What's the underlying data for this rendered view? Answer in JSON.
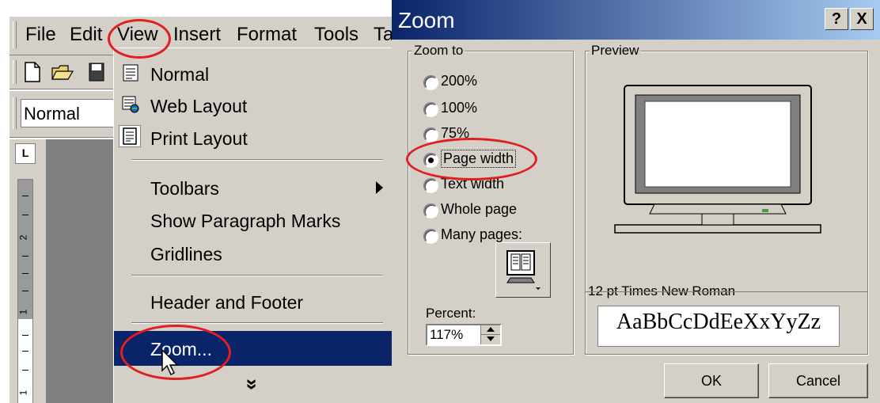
{
  "menubar": {
    "items": [
      {
        "label": "File",
        "mnemonic": "F"
      },
      {
        "label": "Edit",
        "mnemonic": "E"
      },
      {
        "label": "View",
        "mnemonic": "V"
      },
      {
        "label": "Insert",
        "mnemonic": "I"
      },
      {
        "label": "Format",
        "mnemonic": "o"
      },
      {
        "label": "Tools",
        "mnemonic": "T"
      },
      {
        "label": "Ta",
        "mnemonic": ""
      }
    ]
  },
  "toolbar": {
    "style_value": "Normal",
    "tab_selector": "L"
  },
  "ruler": {
    "numbers": [
      "2",
      "1",
      "1"
    ]
  },
  "view_menu": {
    "items": {
      "normal": "Normal",
      "web_layout": "Web Layout",
      "print_layout": "Print Layout",
      "toolbars": "Toolbars",
      "show_paragraph_marks": "Show Paragraph Marks",
      "gridlines": "Gridlines",
      "header_footer": "Header and Footer",
      "zoom": "Zoom...",
      "more": "»"
    }
  },
  "zoom_dialog": {
    "title": "Zoom",
    "help_button": "?",
    "close_button": "X",
    "zoom_to_label": "Zoom to",
    "options": [
      "200%",
      "100%",
      "75%",
      "Page width",
      "Text width",
      "Whole page",
      "Many pages:"
    ],
    "selected_option": "Page width",
    "percent_label": "Percent:",
    "percent_value": "117%",
    "preview_label": "Preview",
    "font_label": "12 pt Times New Roman",
    "sample_text": "AaBbCcDdEeXxYyZz",
    "ok_label": "OK",
    "cancel_label": "Cancel"
  },
  "colors": {
    "face": "#d4d0c8",
    "highlight": "#0a246a",
    "annotation": "#e02020"
  }
}
